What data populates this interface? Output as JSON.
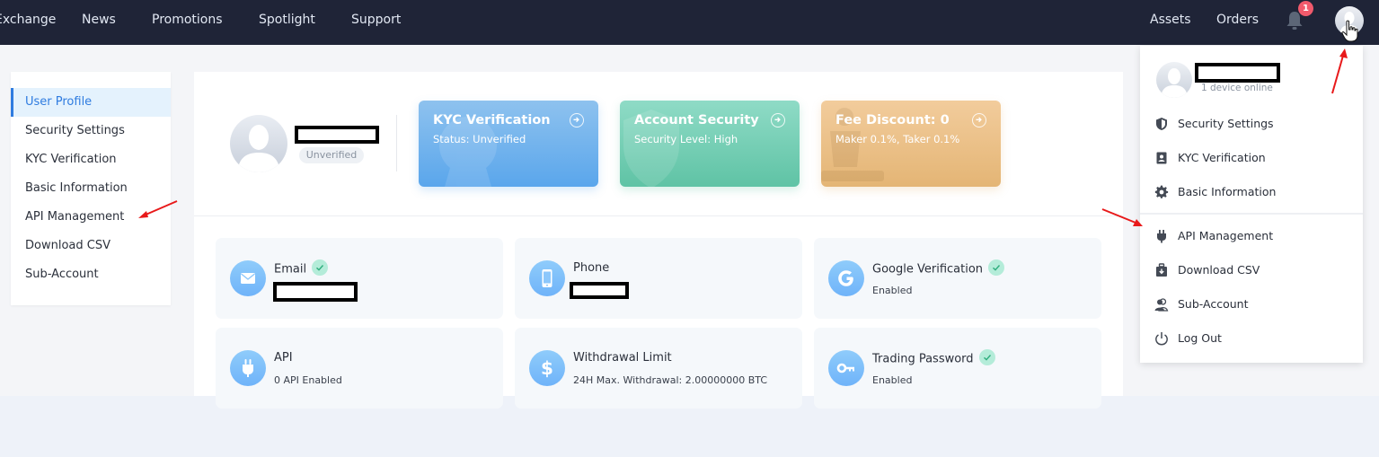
{
  "navbar": {
    "left_links": [
      "Exchange",
      "News",
      "Promotions",
      "Spotlight",
      "Support"
    ],
    "right_links": [
      "Assets",
      "Orders"
    ],
    "notification_count": "1",
    "icons": {
      "bell": "bell-icon",
      "avatar": "user-avatar-icon"
    }
  },
  "sidebar": {
    "active_index": 0,
    "items": [
      {
        "label": "User Profile"
      },
      {
        "label": "Security Settings"
      },
      {
        "label": "KYC Verification"
      },
      {
        "label": "Basic Information"
      },
      {
        "label": "API Management"
      },
      {
        "label": "Download CSV"
      },
      {
        "label": "Sub-Account"
      }
    ]
  },
  "profile": {
    "username": "[redacted]",
    "status_tag": "Unverified"
  },
  "cards": [
    {
      "title": "KYC Verification",
      "subtitle": "Status: Unverified",
      "color": "#6aaeee",
      "icon": "ribbon-icon"
    },
    {
      "title": "Account Security",
      "subtitle": "Security Level: High",
      "color": "#72cdb2",
      "icon": "shield-icon"
    },
    {
      "title": "Fee Discount: 0",
      "subtitle": "Maker 0.1%, Taker 0.1%",
      "color": "#ebc287",
      "icon": "chess-icon"
    }
  ],
  "tiles": [
    {
      "name": "Email",
      "value": "[redacted]",
      "verified": true,
      "icon": "envelope-icon"
    },
    {
      "name": "Phone",
      "value": "[redacted]",
      "verified": false,
      "icon": "phone-icon"
    },
    {
      "name": "Google Verification",
      "value": "Enabled",
      "verified": true,
      "icon": "google-icon"
    },
    {
      "name": "API",
      "value": "0 API Enabled",
      "verified": false,
      "icon": "plug-icon"
    },
    {
      "name": "Withdrawal Limit",
      "value": "24H Max. Withdrawal: 2.00000000 BTC",
      "verified": false,
      "icon": "dollar-icon"
    },
    {
      "name": "Trading Password",
      "value": "Enabled",
      "verified": true,
      "icon": "key-icon"
    }
  ],
  "dropdown": {
    "username": "[redacted]",
    "devices_online": "1 device online",
    "items": [
      {
        "label": "Security Settings",
        "icon": "shield-icon"
      },
      {
        "label": "KYC Verification",
        "icon": "id-badge-icon"
      },
      {
        "label": "Basic Information",
        "icon": "gear-icon"
      },
      {
        "label": "API Management",
        "icon": "plug-icon"
      },
      {
        "label": "Download CSV",
        "icon": "download-case-icon"
      },
      {
        "label": "Sub-Account",
        "icon": "users-icon"
      },
      {
        "label": "Log Out",
        "icon": "power-icon"
      }
    ]
  },
  "colors": {
    "navbar_bg": "#1f2437",
    "accent": "#2f7ce0",
    "badge": "#f05a6c",
    "annotation_arrow": "#e8191a"
  }
}
